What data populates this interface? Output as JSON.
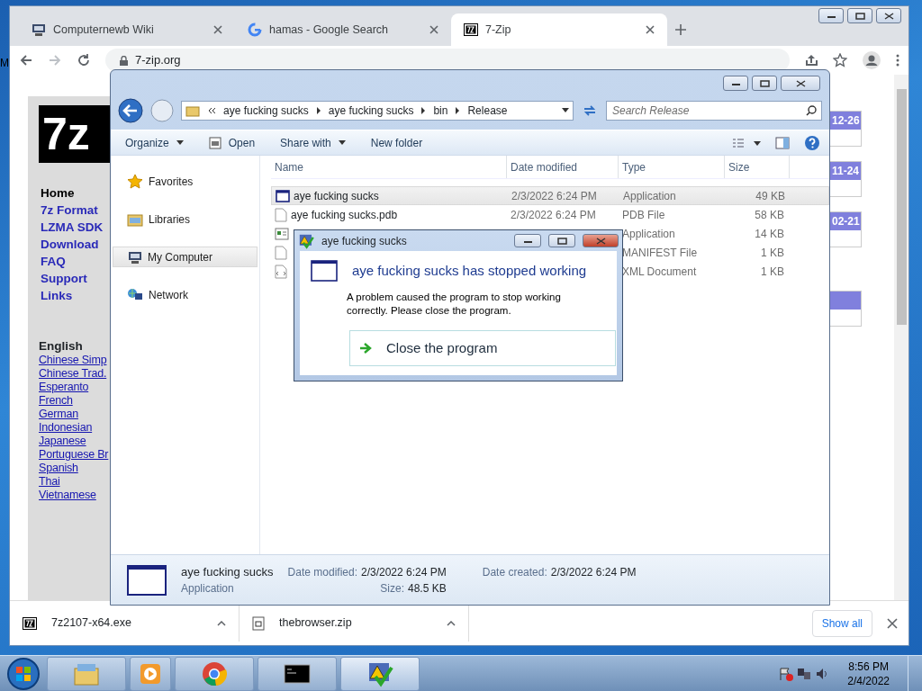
{
  "desktop": {
    "icon_label": "M"
  },
  "browser": {
    "tabs": [
      {
        "title": "Computernewb Wiki",
        "kind": "computer",
        "selected": false
      },
      {
        "title": "hamas - Google Search",
        "kind": "search",
        "selected": false
      },
      {
        "title": "7-Zip",
        "kind": "archive",
        "selected": true
      }
    ],
    "url": "7-zip.org",
    "page": {
      "logo": "7z",
      "nav": [
        {
          "label": "Home",
          "selected": true
        },
        {
          "label": "7z Format",
          "selected": false
        },
        {
          "label": "LZMA SDK",
          "selected": false
        },
        {
          "label": "Download",
          "selected": false
        },
        {
          "label": "FAQ",
          "selected": false
        },
        {
          "label": "Support",
          "selected": false
        },
        {
          "label": "Links",
          "selected": false
        }
      ],
      "language_heading": "English",
      "languages": [
        "Chinese Simp",
        "Chinese Trad.",
        "Esperanto",
        "French",
        "German",
        "Indonesian",
        "Japanese",
        "Portuguese Br",
        "Spanish",
        "Thai",
        "Vietnamese"
      ],
      "dates": [
        "12-26",
        "11-24",
        "02-21"
      ]
    },
    "downloads": [
      {
        "file": "7z2107-x64.exe",
        "kind": "archive"
      },
      {
        "file": "thebrowser.zip",
        "kind": "zip"
      }
    ],
    "show_all": "Show all"
  },
  "explorer": {
    "path": [
      "aye fucking sucks",
      "aye fucking sucks",
      "bin",
      "Release"
    ],
    "search": {
      "placeholder": "Search Release"
    },
    "commands": [
      {
        "label": "Organize",
        "kind": "menu"
      },
      {
        "label": "Open",
        "kind": "open"
      },
      {
        "label": "Share with",
        "kind": "menu"
      },
      {
        "label": "New folder",
        "kind": "plain"
      }
    ],
    "nav": [
      {
        "label": "Favorites",
        "kind": "star",
        "selected": false
      },
      {
        "label": "Libraries",
        "kind": "library",
        "selected": false
      },
      {
        "label": "My Computer",
        "kind": "computer",
        "selected": true
      },
      {
        "label": "Network",
        "kind": "network",
        "selected": false
      }
    ],
    "columns": [
      "Name",
      "Date modified",
      "Type",
      "Size"
    ],
    "files": [
      {
        "name": "aye fucking sucks",
        "date": "2/3/2022 6:24 PM",
        "type": "Application",
        "size": "49 KB",
        "kind": "app",
        "selected": true
      },
      {
        "name": "aye fucking sucks.pdb",
        "date": "2/3/2022 6:24 PM",
        "type": "PDB File",
        "size": "58 KB",
        "kind": "file",
        "selected": false
      },
      {
        "type": "Application",
        "size": "14 KB",
        "kind": "exe",
        "selected": false
      },
      {
        "type": "MANIFEST File",
        "size": "1 KB",
        "kind": "file",
        "selected": false
      },
      {
        "type": "XML Document",
        "size": "1 KB",
        "kind": "xml",
        "selected": false
      }
    ],
    "details": {
      "name": "aye fucking sucks",
      "type": "Application",
      "fields": [
        {
          "label": "Date modified:",
          "value": "2/3/2022 6:24 PM"
        },
        {
          "label": "Size:",
          "value": "48.5 KB"
        },
        {
          "label": "Date created:",
          "value": "2/3/2022 6:24 PM"
        }
      ]
    }
  },
  "dialog": {
    "title": "aye fucking sucks",
    "heading": "aye fucking sucks has stopped working",
    "message": "A problem caused the program to stop working correctly. Please close the program.",
    "action": "Close the program"
  },
  "taskbar": {
    "apps": [
      {
        "kind": "folder",
        "active": false
      },
      {
        "kind": "media",
        "active": false
      },
      {
        "kind": "chrome",
        "active": false
      },
      {
        "kind": "console",
        "active": false
      },
      {
        "kind": "warning",
        "active": true
      }
    ],
    "time": "8:56 PM",
    "date": "2/4/2022"
  }
}
